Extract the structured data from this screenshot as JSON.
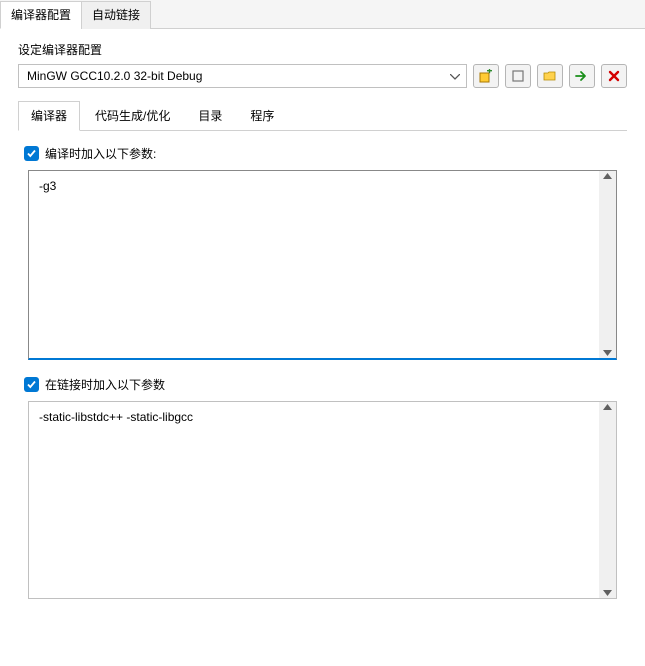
{
  "outerTabs": {
    "compilerConfig": "编译器配置",
    "autoLink": "自动链接"
  },
  "group": {
    "setCompilerConfig": "设定编译器配置"
  },
  "compilerSelect": {
    "selected": "MinGW GCC10.2.0 32-bit Debug"
  },
  "iconButtons": {
    "add": "add-config",
    "rename": "rename-config",
    "folder": "open-folder",
    "next": "next-config",
    "delete": "delete-config"
  },
  "innerTabs": {
    "compiler": "编译器",
    "codegen": "代码生成/优化",
    "directory": "目录",
    "program": "程序"
  },
  "compileSection": {
    "label": "编译时加入以下参数:",
    "value": "-g3"
  },
  "linkSection": {
    "label": "在链接时加入以下参数",
    "value": "-static-libstdc++ -static-libgcc"
  }
}
